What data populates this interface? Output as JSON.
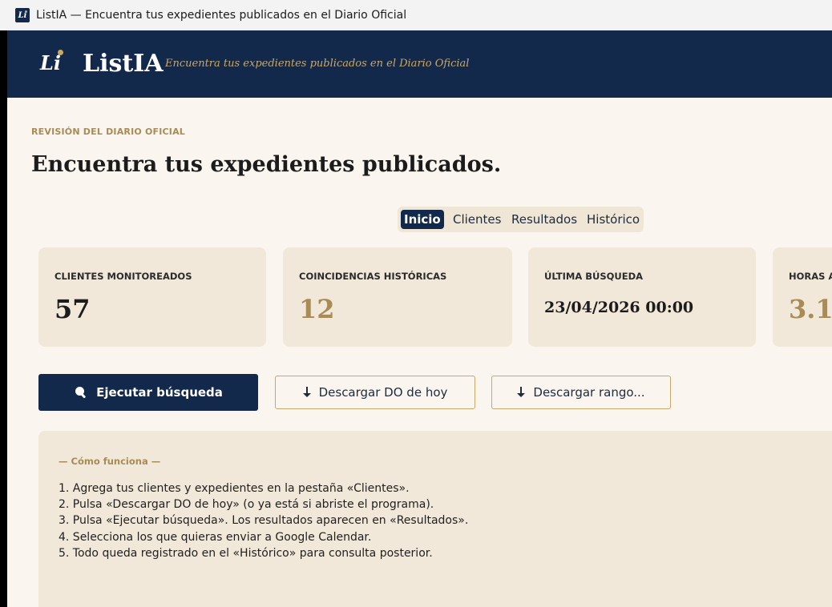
{
  "window": {
    "title": "ListIA — Encuentra tus expedientes publicados en el Diario Oficial",
    "icon_text": "Li"
  },
  "header": {
    "logo_mark": "Li",
    "brand": "ListIA",
    "tagline": "Encuentra tus expedientes publicados en el Diario Oficial"
  },
  "page": {
    "eyebrow": "REVISIÓN DEL DIARIO OFICIAL",
    "title": "Encuentra tus expedientes publicados."
  },
  "tabs": [
    {
      "label": "Inicio",
      "active": true
    },
    {
      "label": "Clientes",
      "active": false
    },
    {
      "label": "Resultados",
      "active": false
    },
    {
      "label": "Histórico",
      "active": false
    }
  ],
  "stats": [
    {
      "label": "CLIENTES MONITOREADOS",
      "value": "57",
      "color": "#1c1c1c"
    },
    {
      "label": "COINCIDENCIAS HISTÓRICAS",
      "value": "12",
      "color": "#a88b55"
    },
    {
      "label": "ÚLTIMA BÚSQUEDA",
      "value": "23/04/2026 00:00",
      "color": "#1c1c1c"
    },
    {
      "label": "HORAS AH",
      "value": "3.1",
      "color": "#a88b55"
    }
  ],
  "actions": {
    "run_search": "Ejecutar búsqueda",
    "download_today": "Descargar DO de hoy",
    "download_range": "Descargar rango..."
  },
  "how_it_works": {
    "title": "— Cómo funciona —",
    "steps": [
      "1.  Agrega tus clientes y expedientes en la pestaña «Clientes».",
      "2.  Pulsa «Descargar DO de hoy» (o ya está si abriste el programa).",
      "3.  Pulsa «Ejecutar búsqueda». Los resultados aparecen en «Resultados».",
      "4.  Selecciona los que quieras enviar a Google Calendar.",
      "5.  Todo queda registrado en el «Histórico» para consulta posterior."
    ]
  },
  "icons": {
    "search": "magnifier-icon",
    "download": "download-arrow-icon"
  },
  "colors": {
    "navy": "#13294b",
    "gold": "#c8a86a",
    "cream": "#faf6ef",
    "card": "#f2e8d9"
  }
}
